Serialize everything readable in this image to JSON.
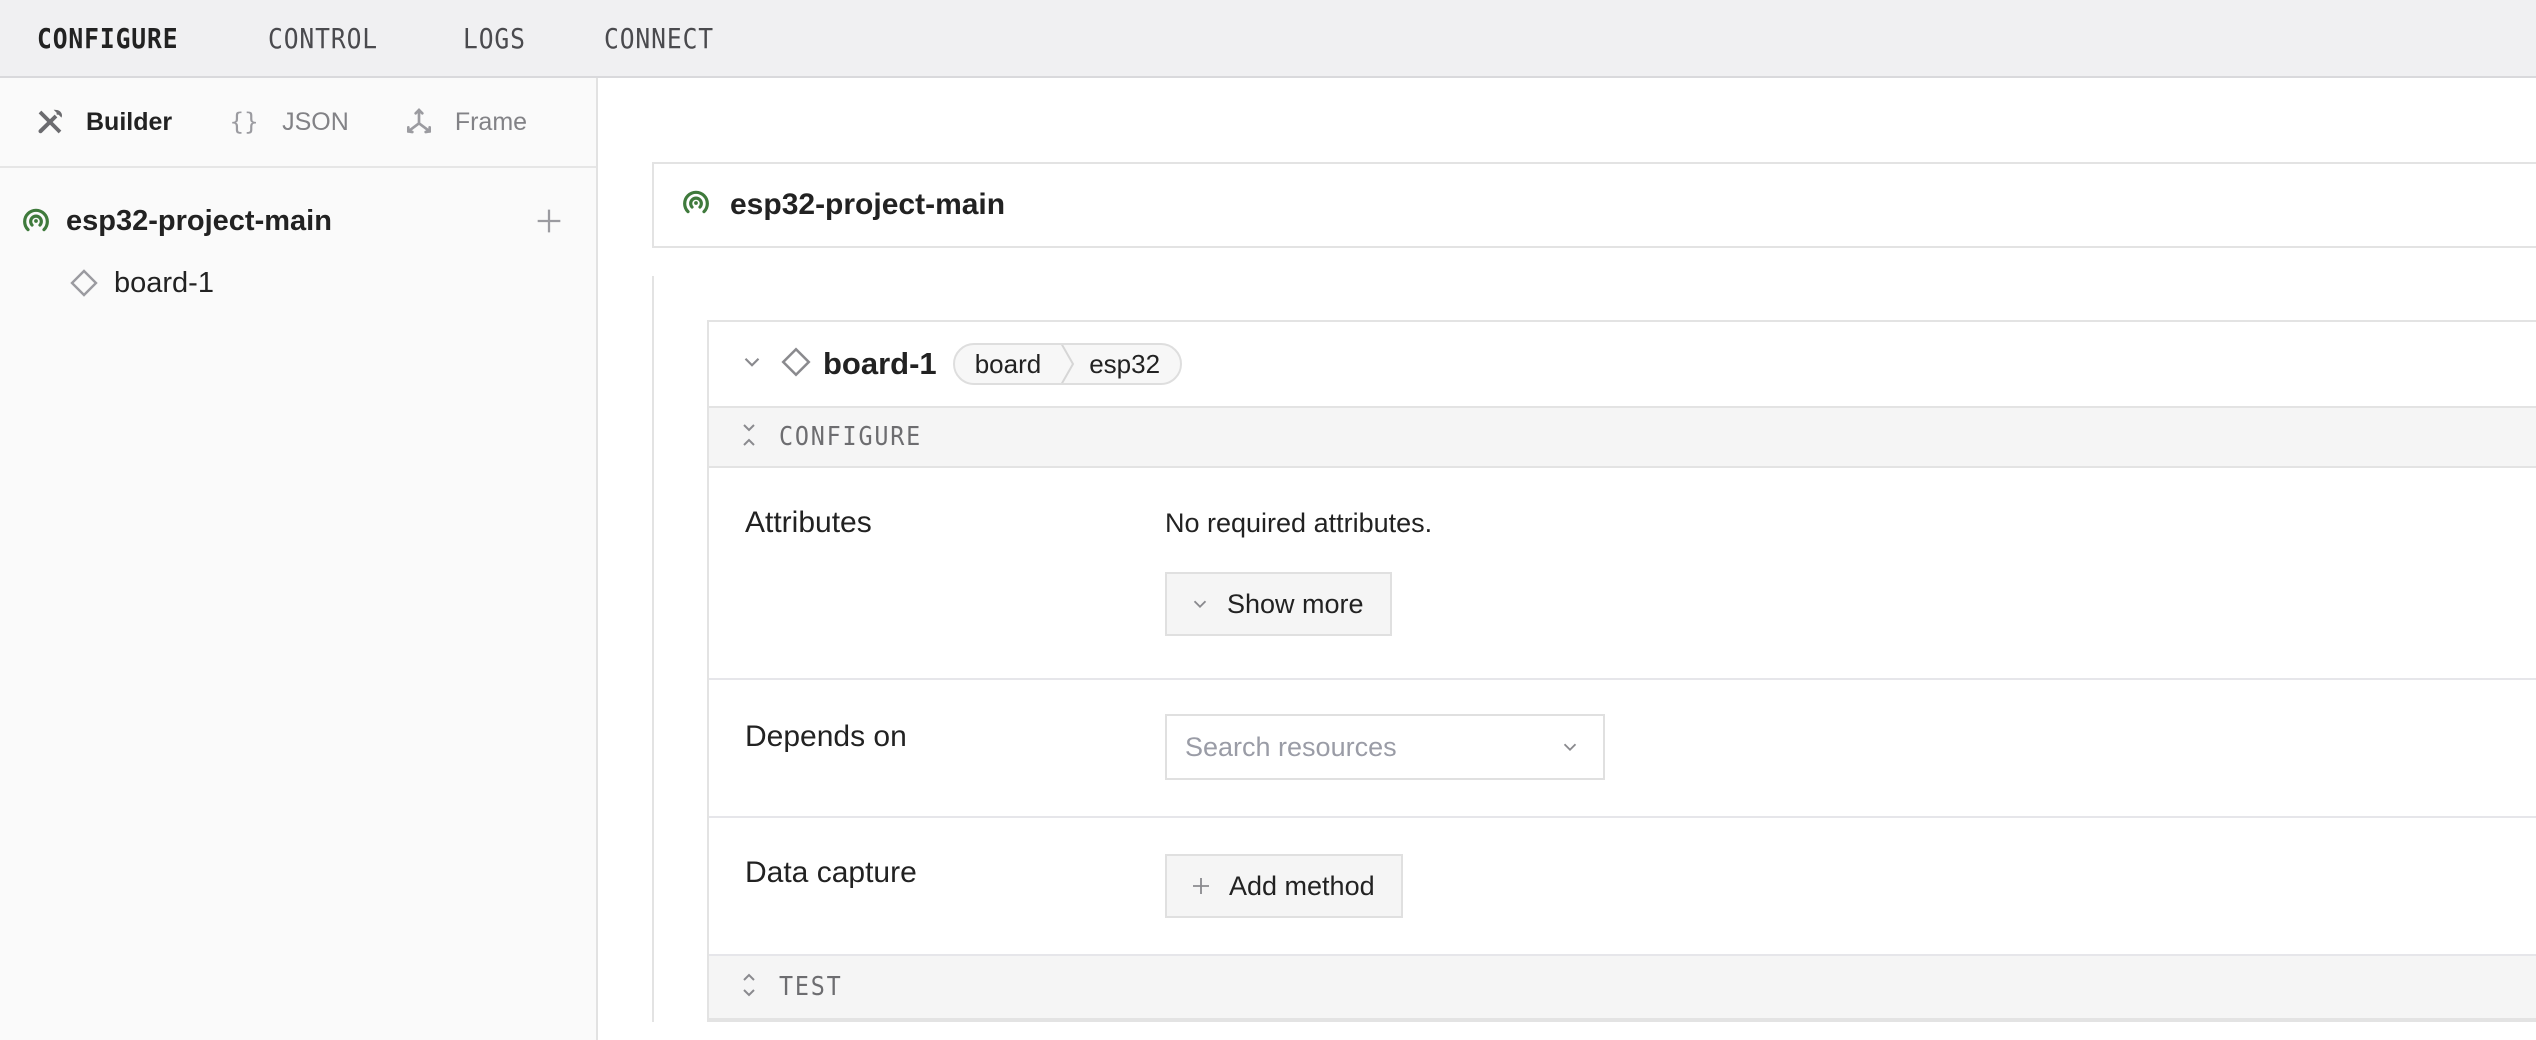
{
  "topbar": {
    "tabs": [
      {
        "label": "CONFIGURE",
        "active": true
      },
      {
        "label": "CONTROL",
        "active": false
      },
      {
        "label": "LOGS",
        "active": false
      },
      {
        "label": "CONNECT",
        "active": false
      }
    ]
  },
  "sidebar": {
    "modes": [
      {
        "label": "Builder",
        "icon": "tools-icon",
        "active": true
      },
      {
        "label": "JSON",
        "icon": "braces-icon",
        "braces": "{}",
        "active": false
      },
      {
        "label": "Frame",
        "icon": "axes-icon",
        "active": false
      }
    ],
    "tree": {
      "root": {
        "label": "esp32-project-main",
        "icon": "machine-signal-icon",
        "add_icon": "plus-icon"
      },
      "children": [
        {
          "label": "board-1",
          "icon": "diamond-icon"
        }
      ]
    }
  },
  "main": {
    "project_title": "esp32-project-main",
    "resource": {
      "name": "board-1",
      "type_chip": [
        "board",
        "esp32"
      ],
      "configure_section": "CONFIGURE",
      "test_section": "TEST",
      "fields": {
        "attributes": {
          "label": "Attributes",
          "value_text": "No required attributes.",
          "button_label": "Show more"
        },
        "depends_on": {
          "label": "Depends on",
          "placeholder": "Search resources"
        },
        "data_capture": {
          "label": "Data capture",
          "button_label": "Add method"
        }
      }
    }
  },
  "colors": {
    "accent_green": "#3f7a3c",
    "icon_gray": "#9b9ba0",
    "topbar_bg": "#f0f0f2"
  }
}
